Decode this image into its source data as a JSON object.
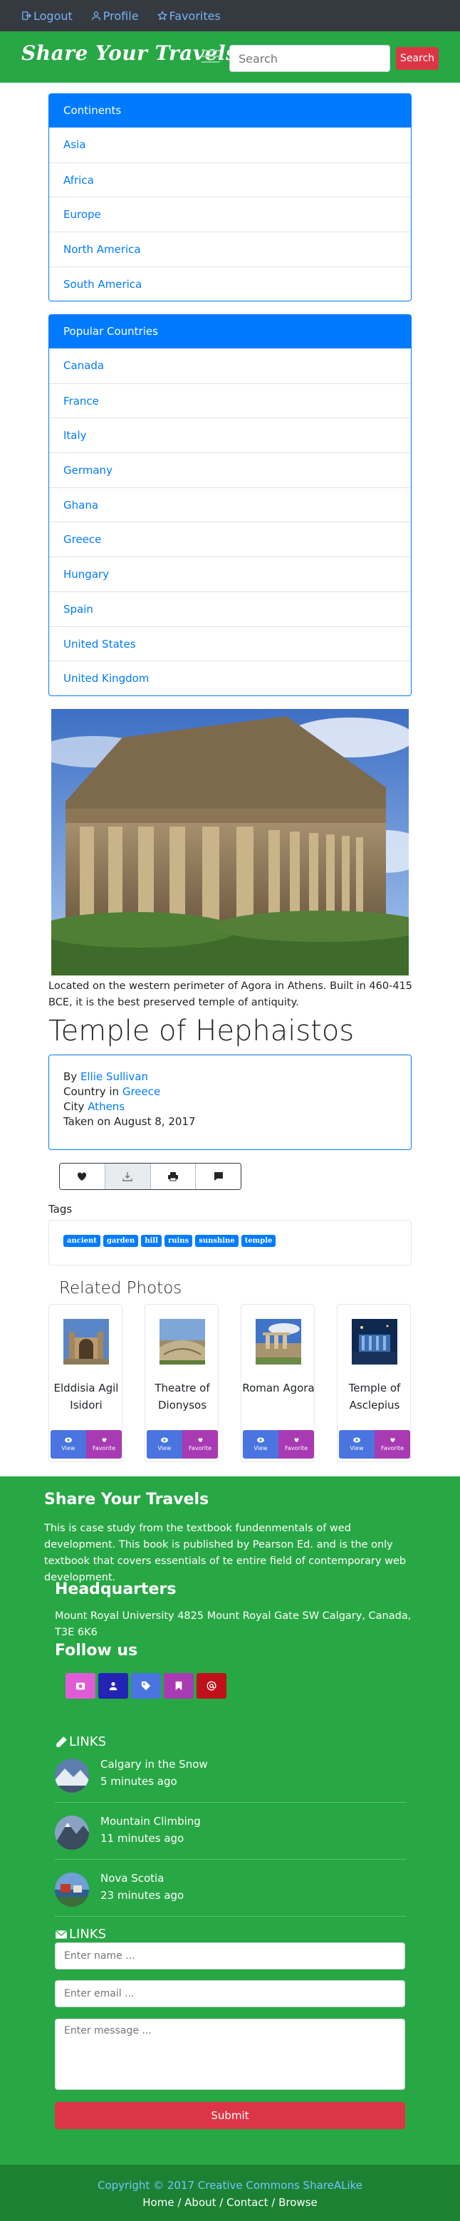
{
  "topbar": {
    "logout": "Logout",
    "profile": "Profile",
    "favorites": "Favorites"
  },
  "navbar": {
    "brand": "Share Your Travels",
    "search_placeholder": "Search",
    "search_button": "Search"
  },
  "continents": {
    "header": "Continents",
    "items": [
      "Asia",
      "Africa",
      "Europe",
      "North America",
      "South America"
    ]
  },
  "countries": {
    "header": "Popular Countries",
    "items": [
      "Canada",
      "France",
      "Italy",
      "Germany",
      "Ghana",
      "Greece",
      "Hungary",
      "Spain",
      "United States",
      "United Kingdom"
    ]
  },
  "photo": {
    "caption": "Located on the western perimeter of Agora in Athens. Built in 460-415 BCE, it is the best preserved temple of antiquity.",
    "title": "Temple of Hephaistos",
    "by_label": "By",
    "author": "Ellie Sullivan",
    "country_label": "Country in",
    "country": "Greece",
    "city_label": "City",
    "city": "Athens",
    "taken": "Taken on August 8, 2017"
  },
  "actions": {
    "buttons": [
      "heart-icon",
      "download-icon",
      "print-icon",
      "comment-icon"
    ]
  },
  "tags": {
    "label": "Tags",
    "items": [
      "ancient",
      "garden",
      "hill",
      "ruins",
      "sunshine",
      "temple"
    ]
  },
  "related": {
    "title": "Related Photos",
    "items": [
      {
        "name": "Elddisia Agil Isidori",
        "view": "View",
        "favorite": "Favorite"
      },
      {
        "name": "Theatre of Dionysos",
        "view": "View",
        "favorite": "Favorite"
      },
      {
        "name": "Roman Agora",
        "view": "View",
        "favorite": "Favorite"
      },
      {
        "name": "Temple of Asclepius",
        "view": "View",
        "favorite": "Favorite"
      }
    ]
  },
  "footer": {
    "title": "Share Your Travels",
    "description": "This is case study from the textbook fundenmentals of wed development. This book is published by Pearson Ed. and is the only textbook that covers essentials of te entire field of contemporary web development.",
    "hq_title": "Headquarters",
    "address": "Mount Royal University 4825 Mount Royal Gate SW Calgary, Canada, T3E 6K6",
    "follow_title": "Follow us",
    "socials": [
      {
        "icon": "instagram-icon",
        "color": "#e05cd6"
      },
      {
        "icon": "user-icon",
        "color": "#2323b5"
      },
      {
        "icon": "tag-icon",
        "color": "#4a74e0"
      },
      {
        "icon": "bookmark-icon",
        "color": "#a83bb3"
      },
      {
        "icon": "at-icon",
        "color": "#c0111a"
      }
    ],
    "links_title_1": "LINKS",
    "links": [
      {
        "title": "Calgary in the Snow",
        "time": "5 minutes ago"
      },
      {
        "title": "Mountain Climbing",
        "time": "11 minutes ago"
      },
      {
        "title": "Nova Scotia",
        "time": "23 minutes ago"
      }
    ],
    "links_title_2": "LINKS",
    "name_placeholder": "Enter name ...",
    "email_placeholder": "Enter email ...",
    "message_placeholder": "Enter message ...",
    "submit": "Submit",
    "copyright": "Copyright © 2017 Creative Commons ShareALike",
    "bottom_nav": [
      "Home",
      "About",
      "Contact",
      "Browse"
    ]
  },
  "colors": {
    "primary": "#007bff",
    "green": "#28a745",
    "dark": "#343a40",
    "danger": "#dc3545"
  }
}
